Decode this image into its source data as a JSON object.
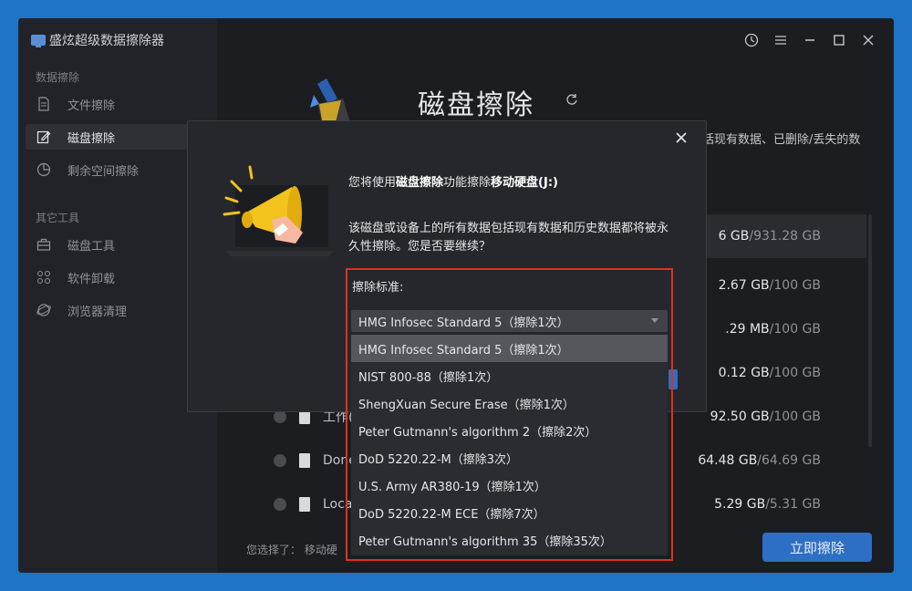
{
  "app": {
    "title": "盛炫超级数据擦除器"
  },
  "sidebar": {
    "section1": "数据擦除",
    "items1": [
      {
        "label": "文件擦除",
        "icon": "file-icon"
      },
      {
        "label": "磁盘擦除",
        "icon": "disk-edit-icon"
      },
      {
        "label": "剩余空间擦除",
        "icon": "pie-chart-icon"
      }
    ],
    "section2": "其它工具",
    "items2": [
      {
        "label": "磁盘工具",
        "icon": "toolbox-icon"
      },
      {
        "label": "软件卸载",
        "icon": "apps-icon"
      },
      {
        "label": "浏览器清理",
        "icon": "browser-icon"
      }
    ]
  },
  "main": {
    "title": "磁盘擦除",
    "desc_tail": "括现有数据、已删除/丢失的数",
    "disks": [
      {
        "name": "",
        "used": "6 GB",
        "total": "/931.28 GB"
      },
      {
        "name": "",
        "used": "2.67 GB",
        "total": "/100 GB"
      },
      {
        "name": "",
        "used": ".29 MB",
        "total": "/100 GB"
      },
      {
        "name": "",
        "used": "0.12 GB",
        "total": "/100 GB"
      },
      {
        "name": "工作(F:)",
        "used": "92.50 GB",
        "total": "/100 GB"
      },
      {
        "name": "Donem",
        "used": "64.48 GB",
        "total": "/64.69 GB"
      },
      {
        "name": "Local D",
        "used": "5.29 GB",
        "total": "/5.31 GB"
      }
    ],
    "footer": "您选择了：  移动硬",
    "erase_button": "立即擦除"
  },
  "modal": {
    "line1_pre": "您将使用",
    "line1_b1": "磁盘擦除",
    "line1_mid": "功能擦除",
    "line1_b2": "移动硬盘(J:)",
    "line2": "该磁盘或设备上的所有数据包括现有数据和历史数据都将被永久性擦除。您是否要继续？",
    "standard_label": "擦除标准:",
    "selected": "HMG Infosec Standard 5（擦除1次）",
    "options": [
      "HMG Infosec Standard 5（擦除1次）",
      "NIST 800-88（擦除1次）",
      "ShengXuan Secure Erase（擦除1次）",
      "Peter Gutmann's algorithm 2（擦除2次）",
      "DoD 5220.22-M（擦除3次）",
      "U.S. Army AR380-19（擦除1次）",
      "DoD 5220.22-M ECE（擦除7次）",
      "Peter Gutmann's algorithm 35（擦除35次）"
    ]
  },
  "colors": {
    "accent": "#2d6fc4",
    "highlight_border": "#e0301e",
    "background": "#1e74c9"
  }
}
